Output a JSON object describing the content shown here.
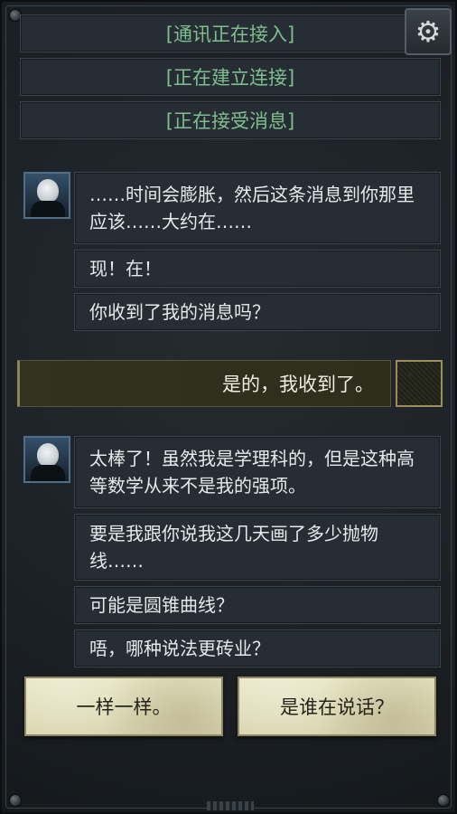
{
  "system_lines": [
    "[通讯正在接入]",
    "[正在建立连接]",
    "[正在接受消息]"
  ],
  "settings_icon": "gear-icon",
  "colors": {
    "system_text": "#7fbf8d",
    "message_bg": "#262d35",
    "reply_bg": "#33311f",
    "choice_bg": "#e3dfbd"
  },
  "messages_group1": [
    "……时间会膨胀，然后这条消息到你那里应该……大约在……",
    "现！在！",
    "你收到了我的消息吗？"
  ],
  "player_reply": "是的，我收到了。",
  "messages_group2": [
    "太棒了！虽然我是学理科的，但是这种高等数学从来不是我的强项。",
    "要是我跟你说我这几天画了多少抛物线……",
    "可能是圆锥曲线？",
    "唔，哪种说法更砖业？"
  ],
  "choices": [
    "一样一样。",
    "是谁在说话？"
  ]
}
